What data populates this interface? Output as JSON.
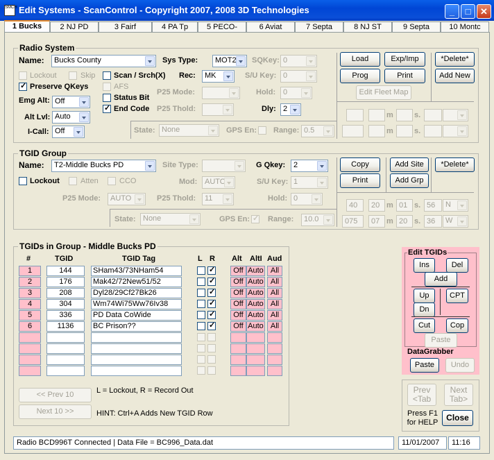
{
  "window": {
    "title": "Edit Systems - ScanControl - Copyright 2007, 2008 3D Technologies",
    "icon_text": "SMCH"
  },
  "tabs": [
    "1 Bucks",
    "2 NJ PD",
    "3 Fairf",
    "4 PA Tp",
    "5 PECO-",
    "6 Aviat",
    "7 Septa",
    "8 NJ ST",
    "9 Septa",
    "10 Montc"
  ],
  "radio_system": {
    "title": "Radio System",
    "name_label": "Name:",
    "name_value": "Bucks County",
    "sys_type_label": "Sys Type:",
    "sys_type_value": "MOT2",
    "sqkey_label": "SQKey:",
    "sqkey_value": "0",
    "su_key_label": "S/U Key:",
    "su_key_value": "0",
    "hold_label": "Hold:",
    "hold_value": "0",
    "dly_label": "Dly:",
    "dly_value": "2",
    "rec_label": "Rec:",
    "rec_value": "MK",
    "p25mode_label": "P25 Mode:",
    "p25thold_label": "P25 Thold:",
    "lockout_label": "Lockout",
    "skip_label": "Skip",
    "scan_label": "Scan / Srch(X)",
    "preserve_label": "Preserve QKeys",
    "afs_label": "AFS",
    "status_bit_label": "Status Bit",
    "end_code_label": "End Code",
    "emg_alt_label": "Emg Alt:",
    "emg_alt_value": "Off",
    "alt_lvl_label": "Alt Lvl:",
    "alt_lvl_value": "Auto",
    "icall_label": "I-Call:",
    "icall_value": "Off",
    "state_label": "State:",
    "state_value": "None",
    "gps_label": "GPS En:",
    "range_label": "Range:",
    "range_value": "0.5",
    "m_label": "m",
    "s_label": "s.",
    "load": "Load",
    "expimp": "Exp/Imp",
    "delete": "*Delete*",
    "prog": "Prog",
    "print": "Print",
    "addnew": "Add New",
    "editfleet": "Edit Fleet Map"
  },
  "tgid_group": {
    "title": "TGID Group",
    "name_label": "Name:",
    "name_value": "T2-Middle Bucks PD",
    "site_type_label": "Site Type:",
    "gqkey_label": "G Qkey:",
    "gqkey_value": "2",
    "lockout_label": "Lockout",
    "atten_label": "Atten",
    "cco_label": "CCO",
    "mod_label": "Mod:",
    "mod_value": "AUTO",
    "su_key_label": "S/U Key:",
    "su_key_value": "1",
    "p25mode_label": "P25 Mode:",
    "p25mode_value": "AUTO",
    "p25thold_label": "P25 Thold:",
    "p25thold_value": "11",
    "hold_label": "Hold:",
    "hold_value": "0",
    "state_label": "State:",
    "state_value": "None",
    "gps_label": "GPS En:",
    "range_label": "Range:",
    "range_value": "10.0",
    "lat": {
      "deg": "40",
      "min": "20",
      "sec": "01",
      "dir": "N",
      "sec2": "56"
    },
    "lon": {
      "deg": "075",
      "min": "07",
      "sec": "20",
      "dir": "W",
      "sec2": "36"
    },
    "m_label": "m",
    "s_label": "s.",
    "copy": "Copy",
    "addsite": "Add Site",
    "delete": "*Delete*",
    "print": "Print",
    "addgrp": "Add Grp"
  },
  "tgids": {
    "title": "TGIDs in Group - Middle Bucks PD",
    "headers": {
      "num": "#",
      "tgid": "TGID",
      "tag": "TGID Tag",
      "l": "L",
      "r": "R",
      "alt": "Alt",
      "altl": "AltI",
      "aud": "Aud"
    },
    "rows": [
      {
        "num": "1",
        "tgid": "144",
        "tag": "SHam43/73NHam54",
        "alt": "Off",
        "altl": "Auto",
        "aud": "All"
      },
      {
        "num": "2",
        "tgid": "176",
        "tag": "Mak42/72New51/52",
        "alt": "Off",
        "altl": "Auto",
        "aud": "All"
      },
      {
        "num": "3",
        "tgid": "208",
        "tag": "Dyl28/29Cf27Bk26",
        "alt": "Off",
        "altl": "Auto",
        "aud": "All"
      },
      {
        "num": "4",
        "tgid": "304",
        "tag": "Wm74Wi75Ww76Iv38",
        "alt": "Off",
        "altl": "Auto",
        "aud": "All"
      },
      {
        "num": "5",
        "tgid": "336",
        "tag": "PD Data CoWide",
        "alt": "Off",
        "altl": "Auto",
        "aud": "All"
      },
      {
        "num": "6",
        "tgid": "1136",
        "tag": "BC Prison??",
        "alt": "Off",
        "altl": "Auto",
        "aud": "All"
      }
    ],
    "prev": "<< Prev 10",
    "next": "Next 10 >>",
    "legend": "L = Lockout, R = Record Out",
    "hint": "HINT:  Ctrl+A Adds New TGID Row"
  },
  "edit_tgids": {
    "title": "Edit TGIDs",
    "ins": "Ins",
    "del": "Del",
    "add": "Add",
    "up": "Up",
    "dn": "Dn",
    "cpt": "CPT",
    "cut": "Cut",
    "cop": "Cop",
    "paste": "Paste",
    "datagrabber": "DataGrabber",
    "dg_paste": "Paste",
    "undo": "Undo"
  },
  "nav": {
    "prev_tab": "Prev\n<Tab",
    "next_tab": "Next\nTab>",
    "help": "Press F1\nfor HELP",
    "close": "Close"
  },
  "status": {
    "message": "Radio BCD996T Connected | Data File = BC996_Data.dat",
    "date": "11/01/2007",
    "time": "11:16"
  }
}
